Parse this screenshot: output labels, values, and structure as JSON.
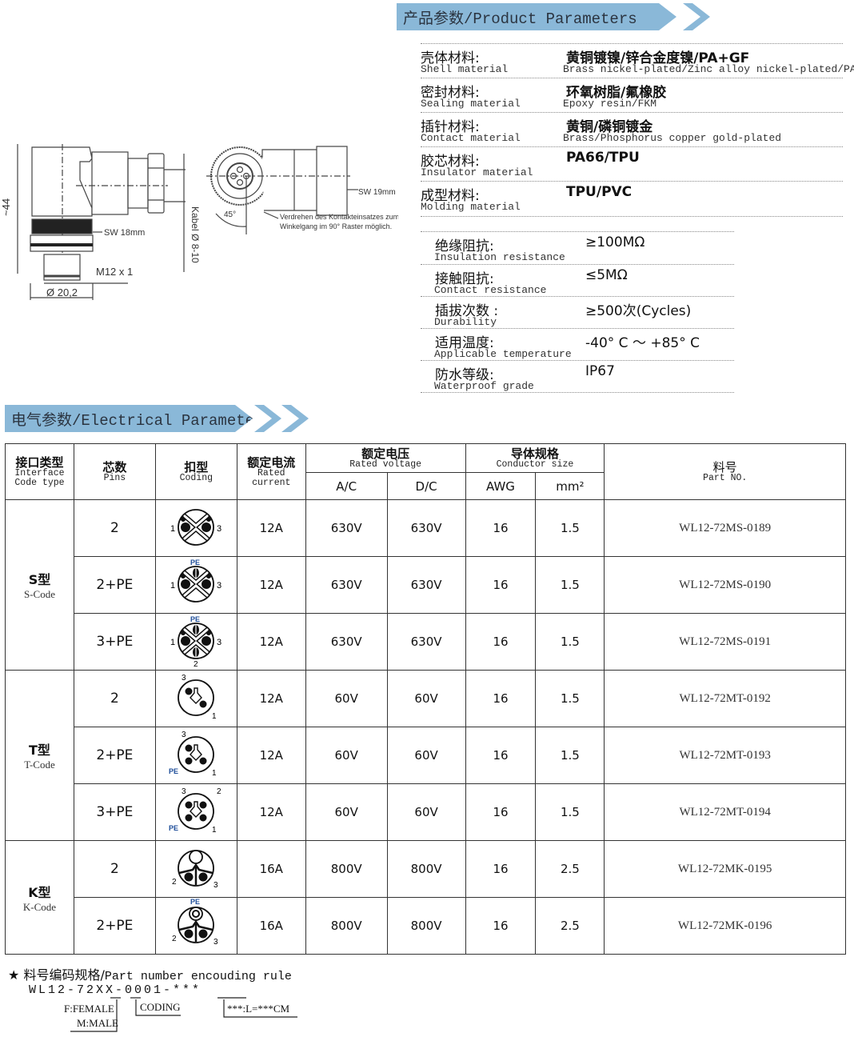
{
  "product_section": {
    "title": "产品参数/Product Parameters",
    "materials": [
      {
        "label_cn": "壳体材料:",
        "label_en": "Shell material",
        "value_cn": "黄铜镀镍/锌合金度镍/PA+GF",
        "value_en": "Brass nickel-plated/Zinc alloy nickel-plated/PA-GF"
      },
      {
        "label_cn": "密封材料:",
        "label_en": "Sealing material",
        "value_cn": "环氧树脂/氟橡胶",
        "value_en": "Epoxy resin/FKM"
      },
      {
        "label_cn": "插针材料:",
        "label_en": "Contact material",
        "value_cn": "黄铜/磷铜镀金",
        "value_en": "Brass/Phosphorus copper gold-plated"
      },
      {
        "label_cn": "胶芯材料:",
        "label_en": "Insulator material",
        "value_cn": "PA66/TPU",
        "value_en": ""
      },
      {
        "label_cn": "成型材料:",
        "label_en": "Molding material",
        "value_cn": "TPU/PVC",
        "value_en": ""
      }
    ],
    "specs": [
      {
        "label_cn": "绝缘阻抗:",
        "label_en": "Insulation resistance",
        "value": "≥100MΩ"
      },
      {
        "label_cn": "接触阻抗:",
        "label_en": "Contact resistance",
        "value": "≤5MΩ"
      },
      {
        "label_cn": "插拔次数 :",
        "label_en": "Durability",
        "value": "≥500次(Cycles)"
      },
      {
        "label_cn": "适用温度:",
        "label_en": "Applicable temperature",
        "value": "-40° C ～ +85° C"
      },
      {
        "label_cn": "防水等级:",
        "label_en": "Waterproof grade",
        "value": "IP67"
      }
    ]
  },
  "drawing": {
    "height_label": "~44",
    "sw1": "SW 18mm",
    "thread": "M12 x 1",
    "diameter": "Ø 20,2",
    "cable": "Kabel Ø 8-10",
    "angle": "45°",
    "sw2": "SW 19mm",
    "note_line1": "Verdrehen des Kontakteinsatzes zum",
    "note_line2": "Winkelgang im 90° Raster möglich."
  },
  "electrical_section": {
    "title": "电气参数/Electrical Parameters",
    "headers": {
      "interface_cn": "接口类型",
      "interface_en1": "Interface",
      "interface_en2": "Code  type",
      "pins_cn": "芯数",
      "pins_en": "Pins",
      "coding_cn": "扣型",
      "coding_en": "Coding",
      "current_cn": "额定电流",
      "current_en": "Rated current",
      "voltage_cn": "额定电压",
      "voltage_en": "Rated voltage",
      "ac": "A/C",
      "dc": "D/C",
      "conductor_cn": "导体规格",
      "conductor_en": "Conductor size",
      "awg": "AWG",
      "mm2": "mm²",
      "part_cn": "料号",
      "part_en": "Part NO."
    },
    "groups": [
      {
        "name_cn": "S型",
        "name_en": "S-Code"
      },
      {
        "name_cn": "T型",
        "name_en": "T-Code"
      },
      {
        "name_cn": "K型",
        "name_en": "K-Code"
      }
    ],
    "rows": [
      {
        "pins": "2",
        "coding": "S-2",
        "current": "12A",
        "ac": "630V",
        "dc": "630V",
        "awg": "16",
        "mm2": "1.5",
        "part": "WL12-72MS-0189"
      },
      {
        "pins": "2+PE",
        "coding": "S-2PE",
        "current": "12A",
        "ac": "630V",
        "dc": "630V",
        "awg": "16",
        "mm2": "1.5",
        "part": "WL12-72MS-0190"
      },
      {
        "pins": "3+PE",
        "coding": "S-3PE",
        "current": "12A",
        "ac": "630V",
        "dc": "630V",
        "awg": "16",
        "mm2": "1.5",
        "part": "WL12-72MS-0191"
      },
      {
        "pins": "2",
        "coding": "T-2",
        "current": "12A",
        "ac": "60V",
        "dc": "60V",
        "awg": "16",
        "mm2": "1.5",
        "part": "WL12-72MT-0192"
      },
      {
        "pins": "2+PE",
        "coding": "T-2PE",
        "current": "12A",
        "ac": "60V",
        "dc": "60V",
        "awg": "16",
        "mm2": "1.5",
        "part": "WL12-72MT-0193"
      },
      {
        "pins": "3+PE",
        "coding": "T-3PE",
        "current": "12A",
        "ac": "60V",
        "dc": "60V",
        "awg": "16",
        "mm2": "1.5",
        "part": "WL12-72MT-0194"
      },
      {
        "pins": "2",
        "coding": "K-2",
        "current": "16A",
        "ac": "800V",
        "dc": "800V",
        "awg": "16",
        "mm2": "2.5",
        "part": "WL12-72MK-0195"
      },
      {
        "pins": "2+PE",
        "coding": "K-2PE",
        "current": "16A",
        "ac": "800V",
        "dc": "800V",
        "awg": "16",
        "mm2": "2.5",
        "part": "WL12-72MK-0196"
      }
    ],
    "pin_labels": {
      "pe": "PE",
      "p1": "1",
      "p2": "2",
      "p3": "3"
    }
  },
  "encoding_rule": {
    "star": "★",
    "title_cn": "料号编码规格/",
    "title_en": "Part number encouding rule",
    "code": "WL12-72XX-0001-***",
    "gender_f": "F:FEMALE",
    "gender_m": "M:MALE",
    "coding": "CODING",
    "length": "***:L=***CM"
  },
  "colors": {
    "banner": "#8ab8d8",
    "pe_label": "#1f4e9a"
  }
}
